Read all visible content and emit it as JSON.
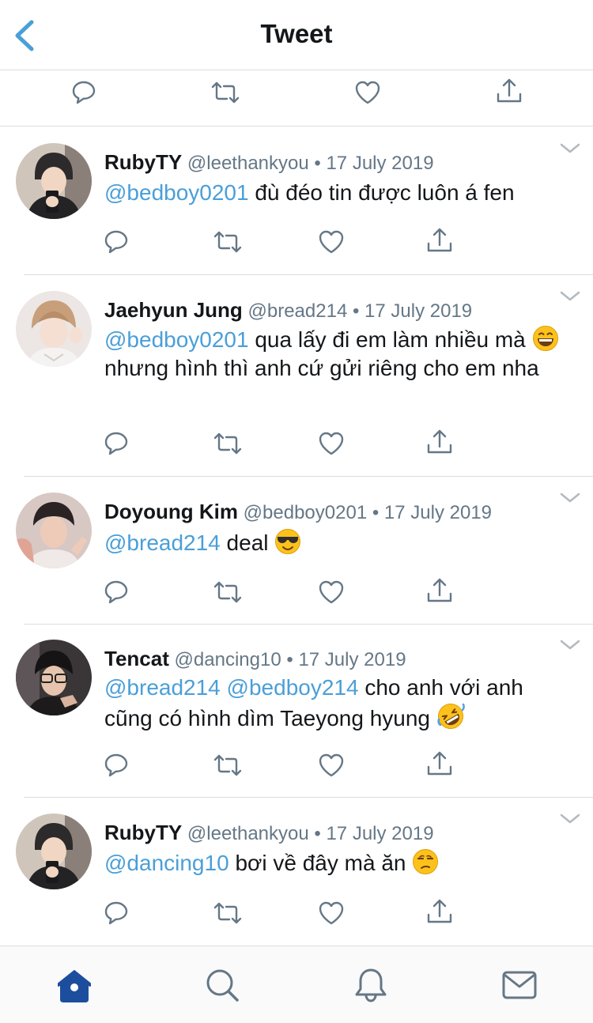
{
  "header": {
    "title": "Tweet",
    "back_icon": "chevron-left-icon"
  },
  "colors": {
    "accent": "#4a9fd8",
    "muted": "#657786",
    "active_tab": "#1d4e9e"
  },
  "tweets": [
    {
      "name": "RubyTY",
      "handle": "@leethankyou",
      "dot": "•",
      "date": "17 July 2019",
      "mentions": [
        "@bedboy0201"
      ],
      "text": "đù đéo tin được luôn á fen"
    },
    {
      "name": "Jaehyun Jung",
      "handle": "@bread214",
      "dot": "•",
      "date": "17 July 2019",
      "mentions": [
        "@bedboy0201"
      ],
      "text1": "qua lấy đi em làm nhiều mà",
      "emoji": "grinning-face-emoji",
      "text2": "nhưng hình thì anh cứ gửi riêng cho em nha"
    },
    {
      "name": "Doyoung Kim",
      "handle": "@bedboy0201",
      "dot": "•",
      "date": "17 July 2019",
      "mentions": [
        "@bread214"
      ],
      "text": "deal",
      "emoji": "sunglasses-face-emoji"
    },
    {
      "name": "Tencat",
      "handle": "@dancing10",
      "dot": "•",
      "date": "17 July 2019",
      "mentions": [
        "@bread214",
        "@bedboy214"
      ],
      "text1": "cho anh với anh",
      "text2": "cũng có hình dìm Taeyong hyung",
      "emoji": "rolling-laughing-face-emoji"
    },
    {
      "name": "RubyTY",
      "handle": "@leethankyou",
      "dot": "•",
      "date": "17 July 2019",
      "mentions": [
        "@dancing10"
      ],
      "text": "bơi về đây mà ăn",
      "emoji": "unamused-face-emoji"
    }
  ],
  "tabbar": {
    "items": [
      "home-icon",
      "search-icon",
      "bell-icon",
      "mail-icon"
    ],
    "active": "home-icon"
  }
}
